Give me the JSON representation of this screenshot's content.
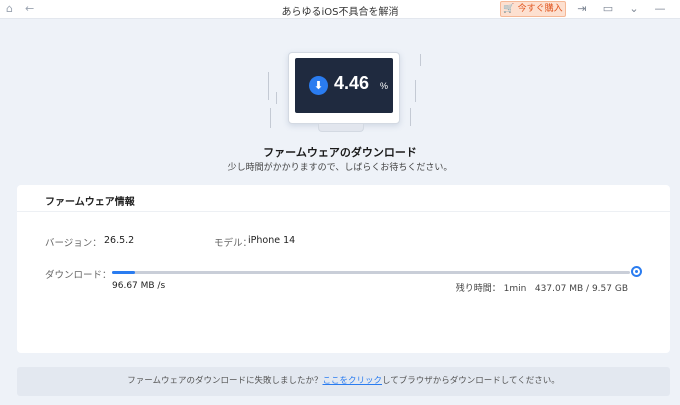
{
  "window": {
    "title": "あらゆるiOS不具合を解消",
    "buy_label": "今すぐ購入",
    "icons": [
      "home-icon",
      "back-arrow-icon",
      "cart-icon",
      "login-icon",
      "feedback-icon",
      "menu-chevron-icon",
      "minimize-icon"
    ]
  },
  "monitor": {
    "percent_value": "4.46",
    "percent_sign": "%"
  },
  "status": {
    "title": "ファームウェアのダウンロード",
    "subtitle": "少し時間がかかりますので、しばらくお待ちください。"
  },
  "firmware": {
    "section_title": "ファームウェア情報",
    "version_label": "バージョン：",
    "version_value": "26.5.2",
    "model_label": "モデル：",
    "model_value": "iPhone 14",
    "download_label": "ダウンロード：",
    "progress": 0.0446,
    "speed": "96.67 MB /s",
    "remaining_label": "残り時間：",
    "remaining_time": "1min",
    "size_progress": "437.07 MB / 9.57 GB"
  },
  "notice": {
    "text_before": "ファームウェアのダウンロードに失敗しましたか？",
    "link_text": "ここをクリック",
    "text_after": "してブラウザからダウンロードしてください。"
  },
  "colors": {
    "accent": "#2a7cf0",
    "buy_button": "#e0551f",
    "screen": "#1f2a3f"
  }
}
